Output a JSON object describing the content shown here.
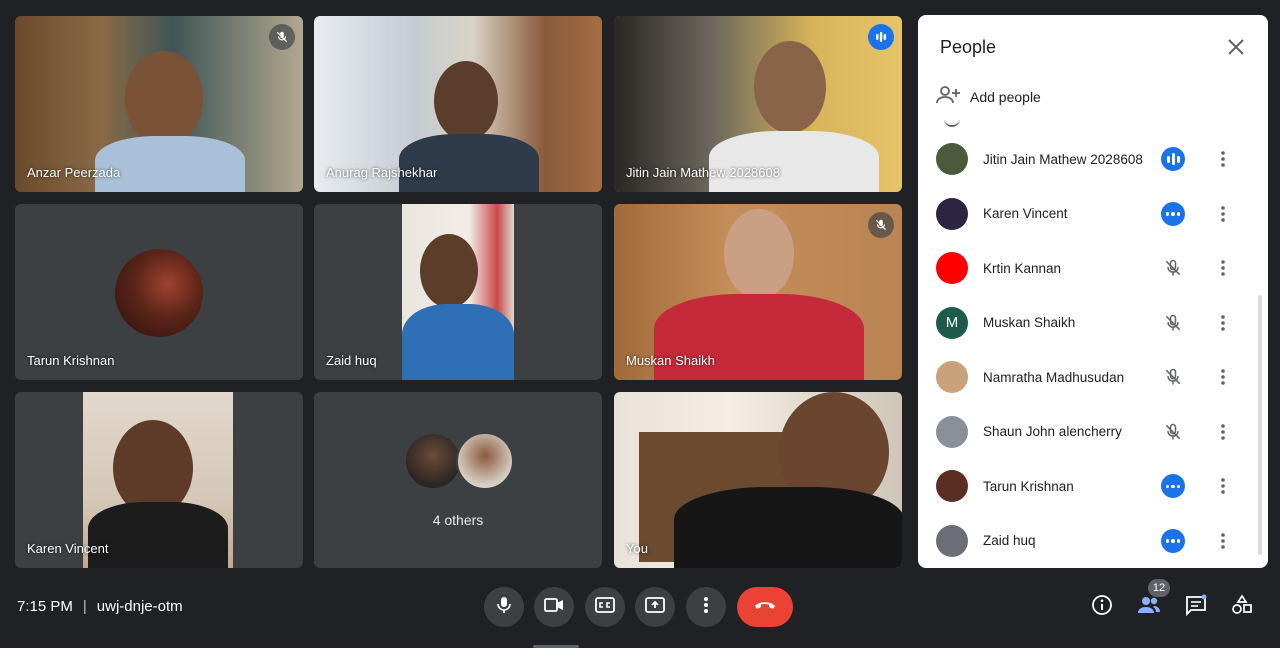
{
  "tiles": [
    {
      "name": "Anzar Peerzada",
      "state": "muted"
    },
    {
      "name": "Anurag Rajshekhar",
      "state": "none"
    },
    {
      "name": "Jitin Jain Mathew 2028608",
      "state": "speaking"
    },
    {
      "name": "Tarun Krishnan",
      "state": "none"
    },
    {
      "name": "Zaid huq",
      "state": "none"
    },
    {
      "name": "Muskan Shaikh",
      "state": "muted"
    },
    {
      "name": "Karen Vincent",
      "state": "none"
    },
    {
      "name": "4 others",
      "state": "none"
    },
    {
      "name": "You",
      "state": "none"
    }
  ],
  "panel": {
    "title": "People",
    "add_people": "Add people",
    "participants": [
      {
        "name": "Jitin Jain Mathew 2028608",
        "status": "speaking",
        "avatar_color": "#4a5a3a",
        "initial": ""
      },
      {
        "name": "Karen Vincent",
        "status": "more",
        "avatar_color": "#2c2440",
        "initial": ""
      },
      {
        "name": "Krtin Kannan",
        "status": "muted",
        "avatar_color": "#ff0000",
        "initial": ""
      },
      {
        "name": "Muskan Shaikh",
        "status": "muted",
        "avatar_color": "#1e5b4a",
        "initial": "M"
      },
      {
        "name": "Namratha Madhusudan",
        "status": "muted",
        "avatar_color": "#c9a27a",
        "initial": ""
      },
      {
        "name": "Shaun John alencherry",
        "status": "muted",
        "avatar_color": "#8a8f99",
        "initial": ""
      },
      {
        "name": "Tarun Krishnan",
        "status": "more",
        "avatar_color": "#5a2e22",
        "initial": ""
      },
      {
        "name": "Zaid huq",
        "status": "more",
        "avatar_color": "#6b6f75",
        "initial": ""
      }
    ]
  },
  "footer": {
    "time": "7:15 PM",
    "separator": "|",
    "meeting_code": "uwj-dnje-otm",
    "people_count": "12"
  },
  "icons": {
    "mic": "microphone-icon",
    "camera": "camera-icon",
    "captions": "captions-icon",
    "present": "present-icon",
    "more": "more-vert-icon",
    "end": "end-call-icon",
    "info": "info-icon",
    "people": "people-icon",
    "chat": "chat-icon",
    "activities": "activities-icon"
  },
  "colors": {
    "background": "#202124",
    "accent": "#1a73e8",
    "end_call": "#ea4335"
  }
}
